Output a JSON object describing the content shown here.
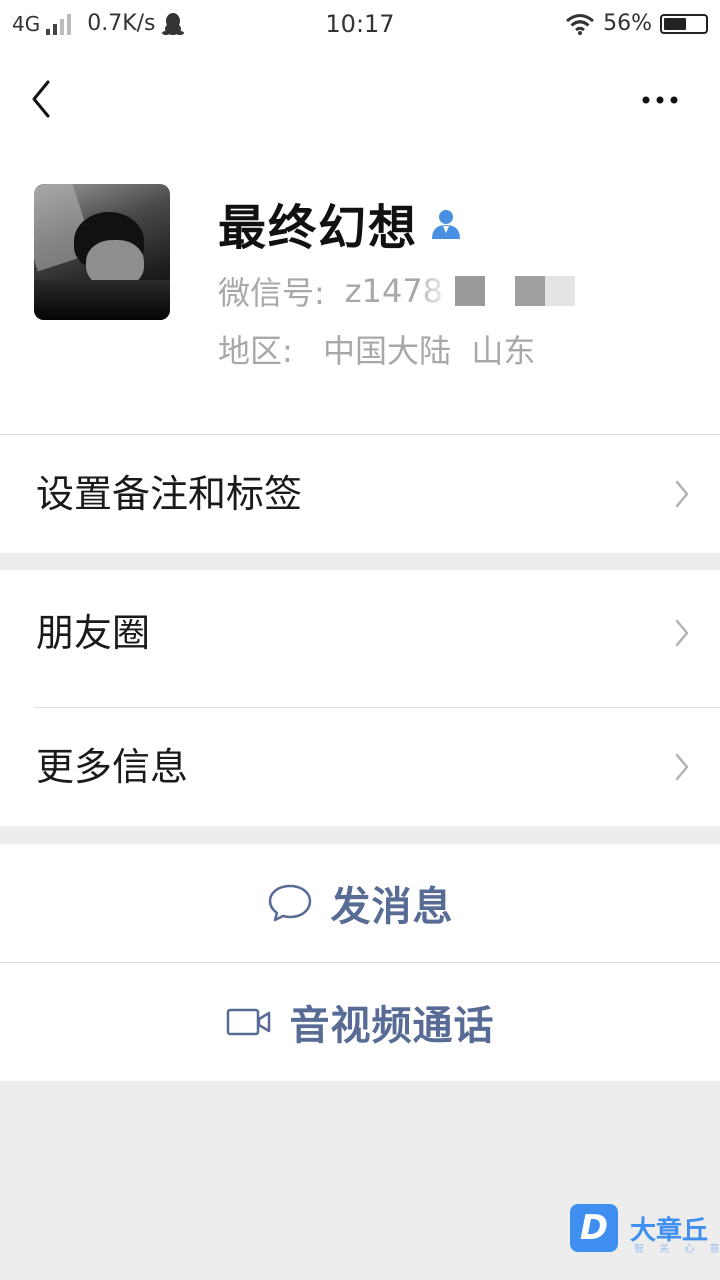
{
  "status_bar": {
    "network": "4G",
    "speed": "0.7K/s",
    "time": "10:17",
    "battery": "56%",
    "battery_level": 0.56
  },
  "profile": {
    "name": "最终幻想",
    "wechat_id_label": "微信号:",
    "wechat_id_visible": "z1478",
    "region_label": "地区:",
    "region_value": "中国大陆  山东"
  },
  "rows": {
    "remark_tags": "设置备注和标签",
    "moments": "朋友圈",
    "more_info": "更多信息"
  },
  "actions": {
    "message": "发消息",
    "video_call": "音视频通话"
  },
  "watermark": {
    "badge": "D",
    "brand": "大章丘",
    "sub": "智 关 心 意"
  },
  "colors": {
    "link": "#576b95",
    "background": "#ededed",
    "verified_icon": "#4a90e2",
    "watermark": "#3f8ff0"
  },
  "icons": {
    "back": "chevron-left-icon",
    "more": "more-dots-icon",
    "chevron": "chevron-right-icon",
    "chat": "chat-bubble-icon",
    "video": "video-camera-icon",
    "person": "person-icon",
    "qq": "qq-penguin-icon",
    "wifi": "wifi-icon",
    "battery": "battery-icon"
  }
}
